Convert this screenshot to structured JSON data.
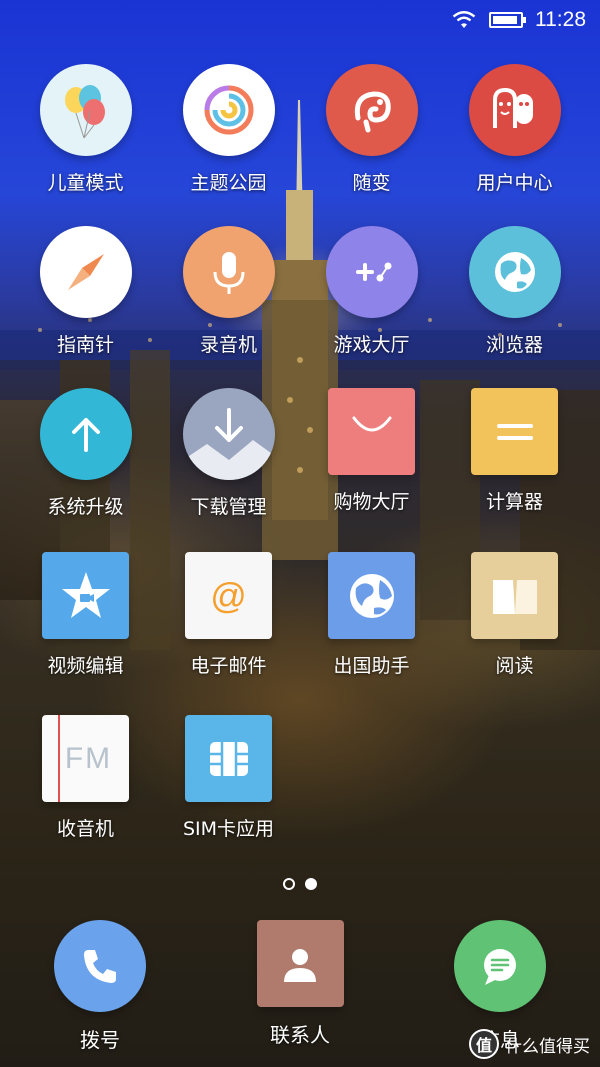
{
  "status": {
    "time": "11:28"
  },
  "apps": [
    {
      "label": "儿童模式"
    },
    {
      "label": "主题公园"
    },
    {
      "label": "随变"
    },
    {
      "label": "用户中心"
    },
    {
      "label": "指南针"
    },
    {
      "label": "录音机"
    },
    {
      "label": "游戏大厅"
    },
    {
      "label": "浏览器"
    },
    {
      "label": "系统升级"
    },
    {
      "label": "下载管理"
    },
    {
      "label": "购物大厅"
    },
    {
      "label": "计算器"
    },
    {
      "label": "视频编辑"
    },
    {
      "label": "电子邮件"
    },
    {
      "label": "出国助手"
    },
    {
      "label": "阅读"
    },
    {
      "label": "收音机",
      "icon_text": "FM"
    },
    {
      "label": "SIM卡应用"
    }
  ],
  "email_icon_text": "@",
  "page_indicator": {
    "current": 2,
    "total": 2
  },
  "dock": [
    {
      "label": "拨号"
    },
    {
      "label": "联系人"
    },
    {
      "label": "信息"
    }
  ],
  "watermark": {
    "text": "什么值得买",
    "logo_text": "值"
  },
  "colors": {
    "kids": "#e3f3f7",
    "theme": "#ffffff",
    "suibian": "#e05a4c",
    "user": "#dc4a44",
    "compass": "#ffffff",
    "recorder": "#f0a36e",
    "game": "#8e83e8",
    "browser": "#5dc0da",
    "update": "#32b8d6",
    "download": "#9aa6c0",
    "shopping": "#ee7e7e",
    "calculator": "#f1c35a",
    "video": "#55a9ea",
    "email": "#f7f7f7",
    "travel": "#6c9de8",
    "reading": "#e6cf9a",
    "fm": "#fafafa",
    "sim": "#5ab6e8",
    "phone": "#6aa3ec",
    "contacts": "#b07a6c",
    "messages": "#5fc275"
  }
}
